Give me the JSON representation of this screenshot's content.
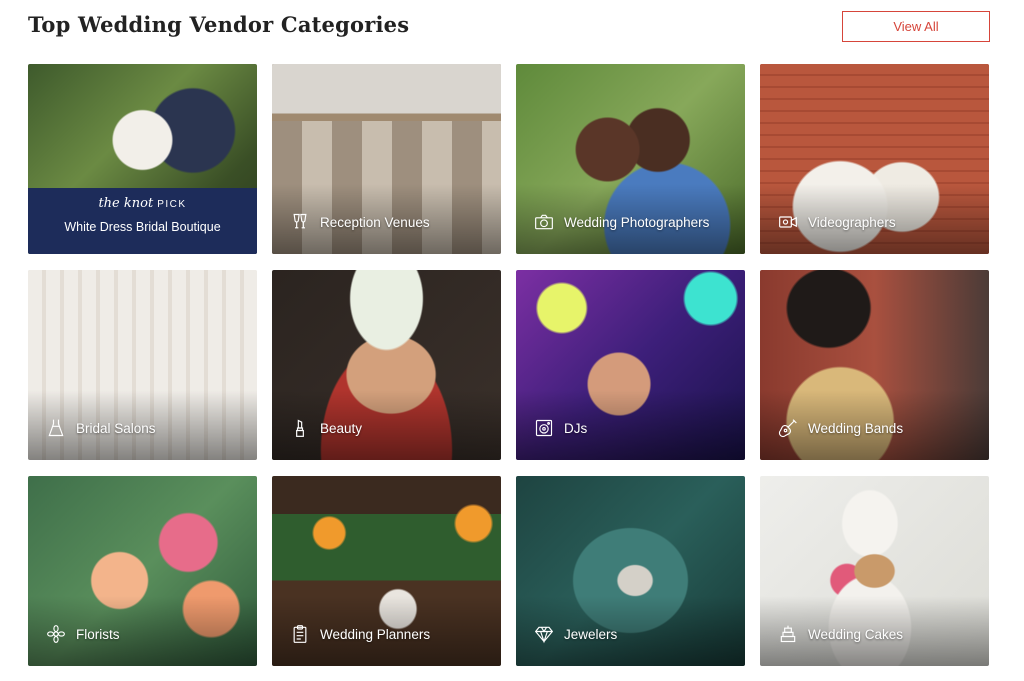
{
  "header": {
    "title": "Top Wedding Vendor Categories",
    "view_all_label": "View All"
  },
  "featured": {
    "logo_script": "the knot",
    "logo_pick": "PICK",
    "vendor_name": "White Dress Bridal Boutique"
  },
  "categories": [
    {
      "label": "Reception Venues",
      "icon": "champagne-glasses-icon"
    },
    {
      "label": "Wedding Photographers",
      "icon": "camera-icon"
    },
    {
      "label": "Videographers",
      "icon": "video-camera-icon"
    },
    {
      "label": "Bridal Salons",
      "icon": "dress-icon"
    },
    {
      "label": "Beauty",
      "icon": "lipstick-icon"
    },
    {
      "label": "DJs",
      "icon": "speaker-icon"
    },
    {
      "label": "Wedding Bands",
      "icon": "guitar-icon"
    },
    {
      "label": "Florists",
      "icon": "flower-icon"
    },
    {
      "label": "Wedding Planners",
      "icon": "clipboard-icon"
    },
    {
      "label": "Jewelers",
      "icon": "diamond-icon"
    },
    {
      "label": "Wedding Cakes",
      "icon": "cake-icon"
    }
  ],
  "colors": {
    "accent": "#d6453a",
    "pick_band": "#1d2c5a"
  }
}
